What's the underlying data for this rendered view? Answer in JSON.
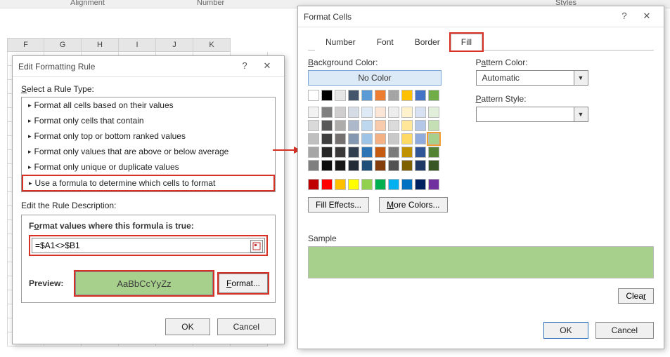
{
  "ribbon": {
    "alignment": "Alignment",
    "number": "Number",
    "styles": "Styles"
  },
  "columns": [
    "F",
    "G",
    "H",
    "I",
    "J",
    "K"
  ],
  "dlg1": {
    "title": "Edit Formatting Rule",
    "select_label": "Select a Rule Type:",
    "rules": [
      "Format all cells based on their values",
      "Format only cells that contain",
      "Format only top or bottom ranked values",
      "Format only values that are above or below average",
      "Format only unique or duplicate values",
      "Use a formula to determine which cells to format"
    ],
    "edit_label": "Edit the Rule Description:",
    "formula_label": "Format values where this formula is true:",
    "formula": "=$A1<>$B1",
    "preview_label": "Preview:",
    "preview_text": "AaBbCcYyZz",
    "format_btn": "Format...",
    "ok": "OK",
    "cancel": "Cancel"
  },
  "dlg2": {
    "title": "Format Cells",
    "tabs": [
      "Number",
      "Font",
      "Border",
      "Fill"
    ],
    "bg_label": "Background Color:",
    "no_color": "No Color",
    "fill_effects": "Fill Effects...",
    "more_colors": "More Colors...",
    "pattern_color_label": "Pattern Color:",
    "pattern_color_value": "Automatic",
    "pattern_style_label": "Pattern Style:",
    "sample_label": "Sample",
    "clear": "Clear",
    "ok": "OK",
    "cancel": "Cancel"
  },
  "palette": {
    "row1": [
      "#ffffff",
      "#000000",
      "#e7e6e6",
      "#44546a",
      "#5b9bd5",
      "#ed7d31",
      "#a5a5a5",
      "#ffc000",
      "#4472c4",
      "#70ad47"
    ],
    "theme": [
      [
        "#f2f2f2",
        "#7f7f7f",
        "#d0cece",
        "#d6dce5",
        "#deebf7",
        "#fbe5d6",
        "#ededed",
        "#fff2cc",
        "#d9e2f3",
        "#e2efda"
      ],
      [
        "#d9d9d9",
        "#595959",
        "#aeabab",
        "#adb9ca",
        "#bdd7ee",
        "#f8cbad",
        "#dbdbdb",
        "#ffe699",
        "#b4c7e7",
        "#c5e0b4"
      ],
      [
        "#bfbfbf",
        "#3f3f3f",
        "#757070",
        "#8497b0",
        "#9dc3e6",
        "#f4b183",
        "#c9c9c9",
        "#ffd966",
        "#8faadc",
        "#a8d08d"
      ],
      [
        "#a6a6a6",
        "#262626",
        "#3a3838",
        "#323f4f",
        "#2e75b6",
        "#c55a11",
        "#7b7b7b",
        "#bf9000",
        "#2f5597",
        "#548235"
      ],
      [
        "#7f7f7f",
        "#0d0d0d",
        "#171616",
        "#222a35",
        "#1f4e79",
        "#833c0c",
        "#525252",
        "#7f6000",
        "#203864",
        "#375623"
      ]
    ],
    "standard": [
      "#c00000",
      "#ff0000",
      "#ffc000",
      "#ffff00",
      "#92d050",
      "#00b050",
      "#00b0f0",
      "#0070c0",
      "#002060",
      "#7030a0"
    ]
  }
}
